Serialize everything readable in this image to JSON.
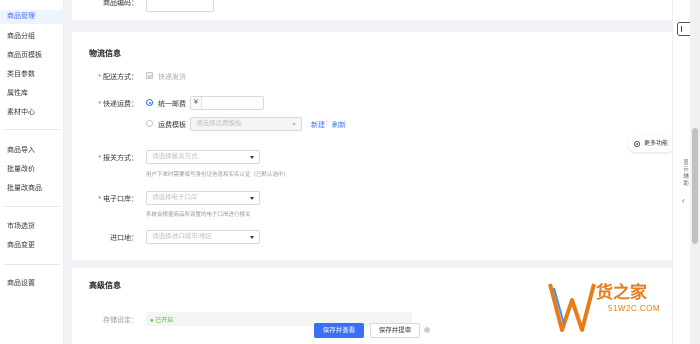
{
  "sidebar": {
    "items": [
      {
        "label": "商品管理",
        "active": true
      },
      {
        "label": "商品分组"
      },
      {
        "label": "商品页模板"
      },
      {
        "label": "类目参数"
      },
      {
        "label": "属性库"
      },
      {
        "label": "素材中心"
      },
      {
        "label": "商品导入"
      },
      {
        "label": "批量改价"
      },
      {
        "label": "批量改商品"
      },
      {
        "label": "市场选货"
      },
      {
        "label": "商品变更"
      },
      {
        "label": "商品设置"
      }
    ]
  },
  "top_section": {
    "label": "商品编码："
  },
  "logistics": {
    "title": "物流信息",
    "delivery": {
      "label": "配送方式：",
      "option": "快递发货"
    },
    "shipping_fee": {
      "label": "快递运费：",
      "option_unified": "统一邮费",
      "currency": "¥",
      "option_template": "运费模板",
      "template_placeholder": "请选择运费模板",
      "new_link": "新建",
      "refresh_link": "刷新"
    },
    "customs_mode": {
      "label": "报关方式：",
      "placeholder": "请选择报关方式",
      "hint": "用户下单时需要填写身份证信息和实名认证（已默认选中）"
    },
    "e_port": {
      "label": "电子口岸：",
      "placeholder": "请选择电子口岸",
      "hint": "系统会根据商品所设置的电子口岸进行报关"
    },
    "import_port": {
      "label": "进口地：",
      "placeholder": "请选择进口城市/地区"
    }
  },
  "advanced": {
    "title": "高级信息",
    "row_label": "存储设定：",
    "row_tag": "● 已开启"
  },
  "float_more": {
    "label": "更多功能"
  },
  "right_rail": {
    "vertical_text": "显示辅助"
  },
  "footer": {
    "save_view": "保存并查看",
    "save_submit": "保存并提审"
  },
  "watermark": {
    "brand": "货之家",
    "url": "51W2C.COM"
  },
  "colors": {
    "accent": "#3a6ff7",
    "required": "#f5222d",
    "watermark": "#e67c1a"
  }
}
